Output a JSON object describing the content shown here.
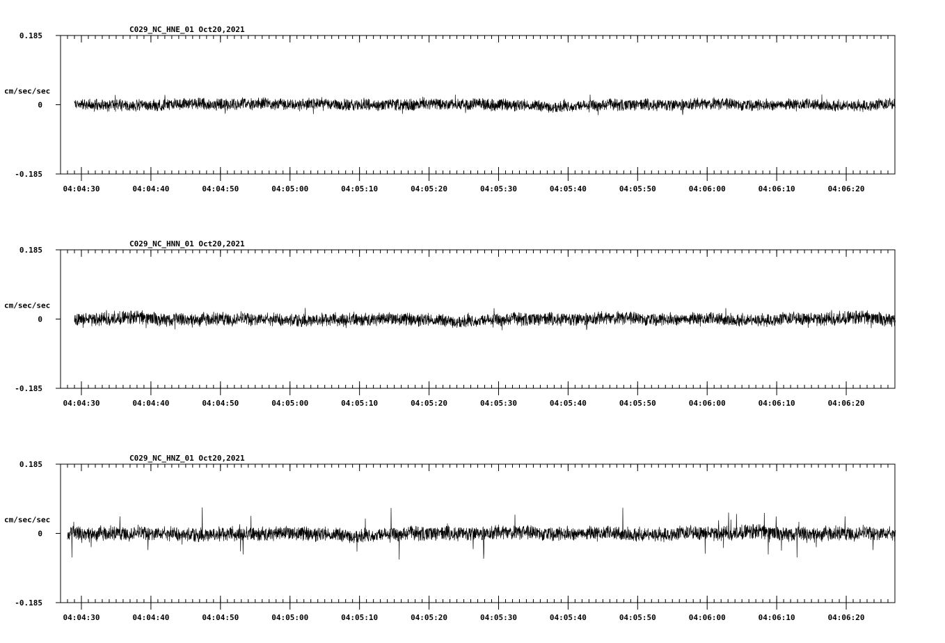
{
  "chart_data": [
    {
      "type": "line",
      "title": "C029_NC_HNE_01   Oct20,2021",
      "ylabel": "cm/sec/sec",
      "ylim": [
        -0.185,
        0.185
      ],
      "y_tick_labels": [
        "0.185",
        "0",
        "-0.185"
      ],
      "xlim": [
        "04:04:27",
        "04:06:27"
      ],
      "x_tick_labels": [
        "04:04:30",
        "04:04:40",
        "04:04:50",
        "04:05:00",
        "04:05:10",
        "04:05:20",
        "04:05:30",
        "04:05:40",
        "04:05:50",
        "04:06:00",
        "04:06:10",
        "04:06:20"
      ],
      "trace_start": "04:04:29",
      "amplitude": 0.018,
      "peak_amplitude": 0.028,
      "grid": false
    },
    {
      "type": "line",
      "title": "C029_NC_HNN_01   Oct20,2021",
      "ylabel": "cm/sec/sec",
      "ylim": [
        -0.185,
        0.185
      ],
      "y_tick_labels": [
        "0.185",
        "0",
        "-0.185"
      ],
      "xlim": [
        "04:04:27",
        "04:06:27"
      ],
      "x_tick_labels": [
        "04:04:30",
        "04:04:40",
        "04:04:50",
        "04:05:00",
        "04:05:10",
        "04:05:20",
        "04:05:30",
        "04:05:40",
        "04:05:50",
        "04:06:00",
        "04:06:10",
        "04:06:20"
      ],
      "trace_start": "04:04:29",
      "amplitude": 0.02,
      "peak_amplitude": 0.03,
      "grid": false
    },
    {
      "type": "line",
      "title": "C029_NC_HNZ_01   Oct20,2021",
      "ylabel": "cm/sec/sec",
      "ylim": [
        -0.185,
        0.185
      ],
      "y_tick_labels": [
        "0.185",
        "0",
        "-0.185"
      ],
      "xlim": [
        "04:04:27",
        "04:06:27"
      ],
      "x_tick_labels": [
        "04:04:30",
        "04:04:40",
        "04:04:50",
        "04:05:00",
        "04:05:10",
        "04:05:20",
        "04:05:30",
        "04:05:40",
        "04:05:50",
        "04:06:00",
        "04:06:10",
        "04:06:20"
      ],
      "trace_start": "04:04:28",
      "amplitude": 0.022,
      "peak_amplitude": 0.07,
      "grid": false
    }
  ]
}
